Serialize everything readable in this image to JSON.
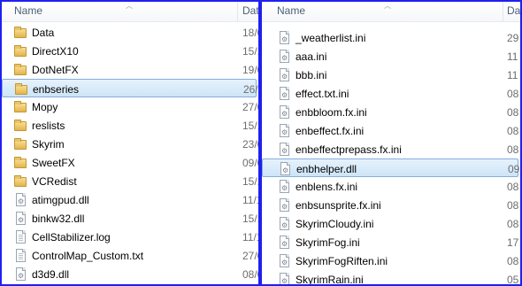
{
  "left_pane": {
    "columns": {
      "name": "Name",
      "date": "Dat"
    },
    "items": [
      {
        "name": "Data",
        "date": "18/0",
        "type": "folder"
      },
      {
        "name": "DirectX10",
        "date": "15/1",
        "type": "folder"
      },
      {
        "name": "DotNetFX",
        "date": "19/0",
        "type": "folder"
      },
      {
        "name": "enbseries",
        "date": "26/1",
        "type": "folder",
        "selected": true
      },
      {
        "name": "Mopy",
        "date": "27/0",
        "type": "folder"
      },
      {
        "name": "reslists",
        "date": "15/1",
        "type": "folder"
      },
      {
        "name": "Skyrim",
        "date": "23/0",
        "type": "folder"
      },
      {
        "name": "SweetFX",
        "date": "09/0",
        "type": "folder"
      },
      {
        "name": "VCRedist",
        "date": "15/1",
        "type": "folder"
      },
      {
        "name": "atimgpud.dll",
        "date": "11/1",
        "type": "dll"
      },
      {
        "name": "binkw32.dll",
        "date": "15/1",
        "type": "dll"
      },
      {
        "name": "CellStabilizer.log",
        "date": "11/1",
        "type": "text"
      },
      {
        "name": "ControlMap_Custom.txt",
        "date": "27/0",
        "type": "text"
      },
      {
        "name": "d3d9.dll",
        "date": "08/0",
        "type": "dll"
      }
    ]
  },
  "right_pane": {
    "columns": {
      "name": "Name",
      "date": "Da"
    },
    "items": [
      {
        "name": "_weatherlist.ini",
        "date": "29",
        "type": "ini"
      },
      {
        "name": "aaa.ini",
        "date": "11",
        "type": "ini"
      },
      {
        "name": "bbb.ini",
        "date": "11",
        "type": "ini"
      },
      {
        "name": "effect.txt.ini",
        "date": "08",
        "type": "ini"
      },
      {
        "name": "enbbloom.fx.ini",
        "date": "08",
        "type": "ini"
      },
      {
        "name": "enbeffect.fx.ini",
        "date": "08",
        "type": "ini"
      },
      {
        "name": "enbeffectprepass.fx.ini",
        "date": "08",
        "type": "ini"
      },
      {
        "name": "enbhelper.dll",
        "date": "09",
        "type": "dll",
        "selected": true
      },
      {
        "name": "enblens.fx.ini",
        "date": "08",
        "type": "ini"
      },
      {
        "name": "enbsunsprite.fx.ini",
        "date": "08",
        "type": "ini"
      },
      {
        "name": "SkyrimCloudy.ini",
        "date": "08",
        "type": "ini"
      },
      {
        "name": "SkyrimFog.ini",
        "date": "17",
        "type": "ini"
      },
      {
        "name": "SkyrimFogRiften.ini",
        "date": "08",
        "type": "ini"
      },
      {
        "name": "SkyrimRain.ini",
        "date": "05",
        "type": "ini"
      }
    ]
  },
  "colors": {
    "pane_border": "#1f1ff0",
    "selection": "#cde5f8",
    "header_text": "#4c607a"
  }
}
